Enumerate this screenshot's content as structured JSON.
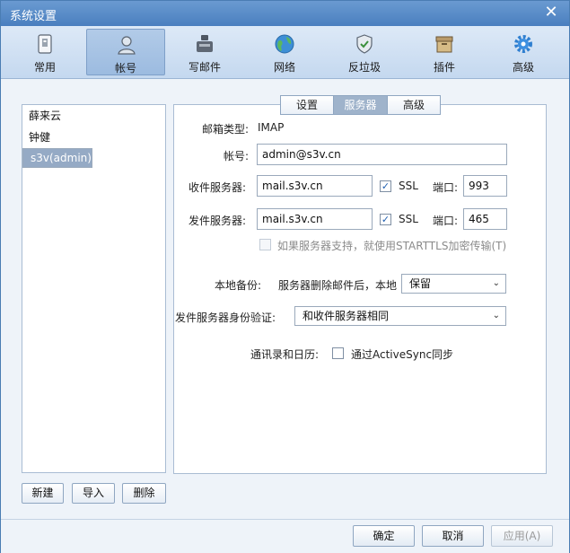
{
  "window": {
    "title": "系统设置",
    "close_glyph": "✕"
  },
  "toolbar": {
    "items": [
      {
        "label": "常用",
        "icon": "general-icon"
      },
      {
        "label": "帐号",
        "icon": "account-icon"
      },
      {
        "label": "写邮件",
        "icon": "compose-icon"
      },
      {
        "label": "网络",
        "icon": "network-icon"
      },
      {
        "label": "反垃圾",
        "icon": "antispam-shield-icon"
      },
      {
        "label": "插件",
        "icon": "plugin-box-icon"
      },
      {
        "label": "高级",
        "icon": "advanced-gear-icon"
      }
    ],
    "active_index": 1
  },
  "accounts": {
    "items": [
      "薛来云",
      "钟健",
      "s3v(admin)"
    ],
    "selected_index": 2,
    "buttons": {
      "new": "新建",
      "import": "导入",
      "delete": "删除"
    }
  },
  "tabs": {
    "items": [
      "设置",
      "服务器",
      "高级"
    ],
    "active_index": 1
  },
  "server": {
    "mail_type_label": "邮箱类型:",
    "mail_type_value": "IMAP",
    "account_label": "帐号:",
    "account_value": "admin@s3v.cn",
    "incoming_label": "收件服务器:",
    "incoming_value": "mail.s3v.cn",
    "incoming_ssl": true,
    "incoming_port": "993",
    "outgoing_label": "发件服务器:",
    "outgoing_value": "mail.s3v.cn",
    "outgoing_ssl": true,
    "outgoing_port": "465",
    "ssl_label": "SSL",
    "port_label": "端口:",
    "check_mark": "✓",
    "starttls_label": "如果服务器支持，就使用STARTTLS加密传输(T)",
    "starttls_checked": false,
    "backup_label": "本地备份:",
    "backup_desc": "服务器删除邮件后，本地",
    "backup_value": "保留",
    "auth_label": "发件服务器身份验证:",
    "auth_value": "和收件服务器相同",
    "sync_label": "通讯录和日历:",
    "sync_option": "通过ActiveSync同步",
    "sync_checked": false,
    "dropdown_arrow": "⌄"
  },
  "footer": {
    "ok": "确定",
    "cancel": "取消",
    "apply": "应用(A)"
  },
  "colors": {
    "accent": "#4a7fbf",
    "selected_row": "#95aac5",
    "active_tab": "#9fb3cb"
  }
}
